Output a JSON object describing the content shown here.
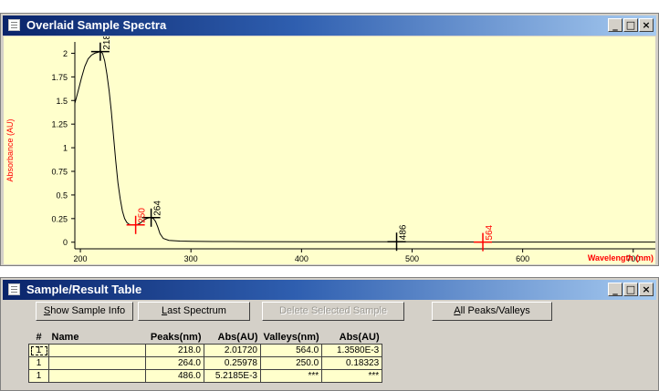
{
  "spectra_window": {
    "title": "Overlaid Sample Spectra",
    "buttons": {
      "minimize": "_",
      "maximize": "□",
      "close": "×"
    }
  },
  "chart_data": {
    "type": "line",
    "ylabel": "Absorbance (AU)",
    "xlabel": "Wavelength (nm)",
    "xlim": [
      195,
      720
    ],
    "ylim": [
      -0.07,
      2.12
    ],
    "x_ticks": [
      200,
      300,
      400,
      500,
      600,
      700
    ],
    "y_ticks": [
      0,
      0.25,
      0.5,
      0.75,
      1,
      1.25,
      1.5,
      1.75,
      2
    ],
    "y_tick_labels": [
      "0",
      "0.25",
      "0.5",
      "0.75",
      "1",
      "1.25",
      "1.5",
      "1.75",
      "2"
    ],
    "grid": false,
    "series": [
      {
        "x": [
          195,
          198,
          201,
          204,
          207,
          210,
          213,
          216,
          218,
          220,
          222,
          224,
          226,
          228,
          230,
          232,
          234,
          236,
          238,
          240,
          242,
          244,
          246,
          248,
          250,
          252,
          254,
          256,
          258,
          260,
          262,
          264,
          266,
          268,
          270,
          272,
          275,
          280,
          290,
          300,
          320,
          350,
          400,
          450,
          486,
          500,
          550,
          564,
          600,
          650,
          700,
          720
        ],
        "y": [
          1.47,
          1.6,
          1.74,
          1.86,
          1.94,
          1.98,
          2.0,
          2.01,
          2.017,
          2.0,
          1.92,
          1.78,
          1.6,
          1.38,
          1.12,
          0.86,
          0.63,
          0.46,
          0.33,
          0.25,
          0.21,
          0.19,
          0.185,
          0.183,
          0.183,
          0.19,
          0.2,
          0.22,
          0.24,
          0.25,
          0.258,
          0.26,
          0.25,
          0.22,
          0.16,
          0.09,
          0.04,
          0.02,
          0.012,
          0.009,
          0.007,
          0.006,
          0.005,
          0.005,
          0.005,
          0.004,
          0.0025,
          0.00136,
          0.001,
          0.001,
          0.001,
          0.001
        ],
        "color": "#000000"
      }
    ],
    "peak_markers": [
      {
        "x": 218,
        "y": 2.017,
        "label": "218",
        "color": "#000000"
      },
      {
        "x": 264,
        "y": 0.26,
        "label": "264",
        "color": "#000000"
      },
      {
        "x": 486,
        "y": 0.0052,
        "label": "486",
        "color": "#000000"
      }
    ],
    "valley_markers": [
      {
        "x": 250,
        "y": 0.183,
        "label": "250",
        "color": "#ff0000"
      },
      {
        "x": 564,
        "y": 0.00136,
        "label": "564",
        "color": "#ff0000"
      }
    ],
    "axis_label_color": "#ff0000"
  },
  "table_window": {
    "title": "Sample/Result Table",
    "buttons": {
      "minimize": "_",
      "maximize": "□",
      "close": "×"
    },
    "toolbar": {
      "show_sample_info_pre": "",
      "show_sample_info_ul": "S",
      "show_sample_info_post": "how Sample Info",
      "last_spectrum_pre": "",
      "last_spectrum_ul": "L",
      "last_spectrum_post": "ast Spectrum",
      "delete_selected": "Delete Selected Sample",
      "all_peaks_pre": "",
      "all_peaks_ul": "A",
      "all_peaks_post": "ll Peaks/Valleys"
    },
    "columns": [
      "#",
      "Name",
      "Peaks(nm)",
      "Abs(AU)",
      "Valleys(nm)",
      "Abs(AU)"
    ],
    "rows": [
      [
        "1",
        "",
        "218.0",
        "2.01720",
        "564.0",
        "1.3580E-3"
      ],
      [
        "1",
        "",
        "264.0",
        "0.25978",
        "250.0",
        "0.18323"
      ],
      [
        "1",
        "",
        "486.0",
        "5.2185E-3",
        "***",
        "***"
      ]
    ]
  }
}
